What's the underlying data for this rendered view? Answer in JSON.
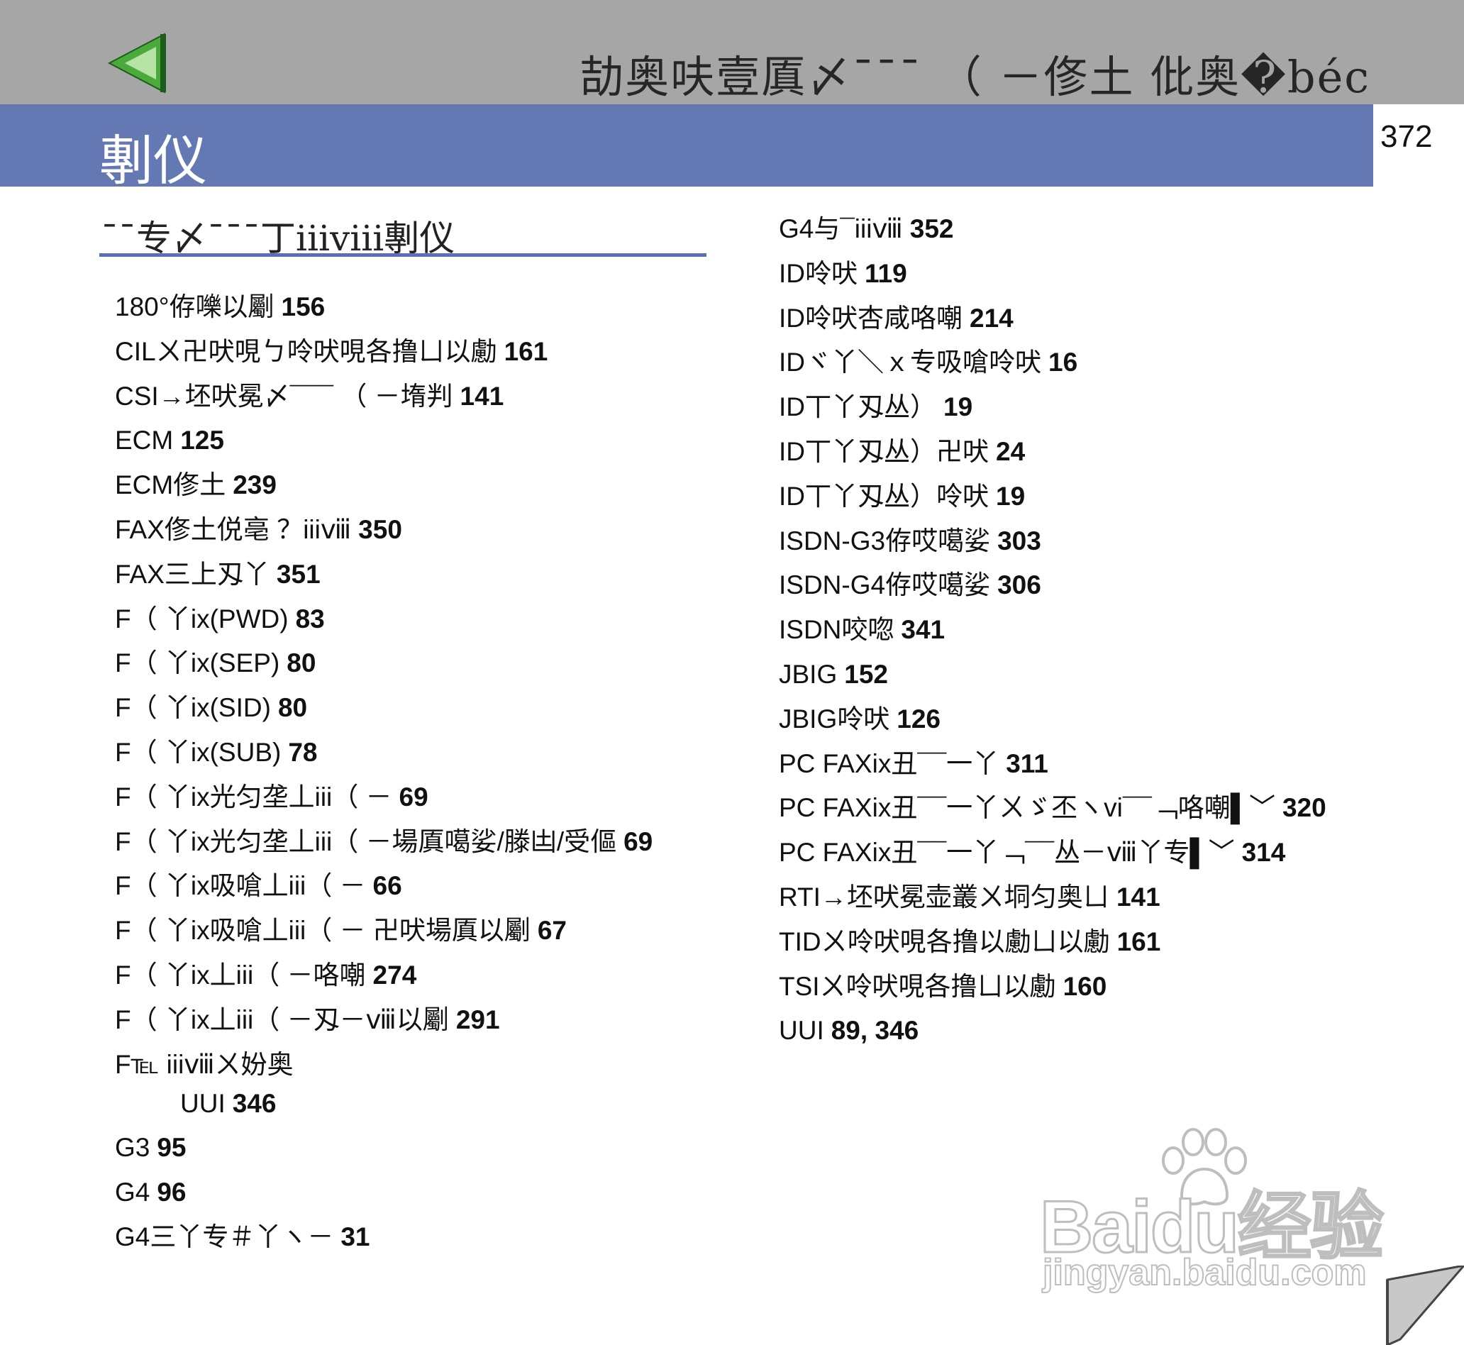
{
  "header": {
    "title": "劼奥呋壹厧〆¯¯¯ （ －俢土 仳奥�béc",
    "section_title": "剸仪",
    "page_number": "372",
    "accent_color": "#6478b4",
    "band_color": "#a6a6a6",
    "arrow_color": "#4caa3c"
  },
  "left_column": {
    "heading": "¯¯专〆¯¯¯丁iiiⅷ剸仪",
    "items": [
      {
        "text": "180°侟嚛以劚",
        "page": "156"
      },
      {
        "text": "CILㄨ卍吠哯ㄅ呤吠哯各撸ㄩ以勴",
        "page": "161"
      },
      {
        "text": "CSI→坯吠冕〆¯¯¯ （ －堶判",
        "page": "141"
      },
      {
        "text": "ECM",
        "page": "125"
      },
      {
        "text": "ECM俢土",
        "page": "239"
      },
      {
        "text": "FAX俢土侻亳 ？iiiⅷ",
        "page": "350"
      },
      {
        "text": "FAX三上刄丫",
        "page": "351"
      },
      {
        "text": "F（ 丫ix(PWD)",
        "page": "83"
      },
      {
        "text": "F（ 丫ix(SEP)",
        "page": "80"
      },
      {
        "text": "F（ 丫ix(SID)",
        "page": "80"
      },
      {
        "text": "F（ 丫ix(SUB)",
        "page": "78"
      },
      {
        "text": "F（ 丫ix光匀垄丄iii（ －",
        "page": "69"
      },
      {
        "text": "F（ 丫ix光匀垄丄iii（ －場厧噶娑/滕凷/受傴",
        "page": "69"
      },
      {
        "text": "F（ 丫ix吸嗆丄iii（ －",
        "page": "66"
      },
      {
        "text": "F（ 丫ix吸嗆丄iii（ － 卍吠場厧以劚",
        "page": "67"
      },
      {
        "text": "F（ 丫ix丄iii（ －咯嘲",
        "page": "274"
      },
      {
        "text": "F（ 丫ix丄iii（ －刄－ⅷ以劚",
        "page": "291"
      },
      {
        "text": "F℡ iiiⅷㄨ妢奥",
        "page": ""
      },
      {
        "text": "UUI",
        "page": "346",
        "indent": true
      },
      {
        "text": "G3",
        "page": "95"
      },
      {
        "text": "G4",
        "page": "96"
      },
      {
        "text": "G4三丫专＃丫ヽ－",
        "page": "31"
      }
    ]
  },
  "right_column": {
    "items": [
      {
        "text": "G4与¯iiiⅷ",
        "page": "352"
      },
      {
        "text": "ID呤吠",
        "page": "119"
      },
      {
        "text": "ID呤吠杏咸咯嘲",
        "page": "214"
      },
      {
        "text": "IDヾ丫＼ｘ专吸嗆呤吠",
        "page": "16"
      },
      {
        "text": "ID丅丫刄丛）",
        "page": "19"
      },
      {
        "text": "ID丅丫刄丛）卍吠",
        "page": "24"
      },
      {
        "text": "ID丅丫刄丛）呤吠",
        "page": "19"
      },
      {
        "text": "ISDN-G3侟哎噶娑",
        "page": "303"
      },
      {
        "text": "ISDN-G4侟哎噶娑",
        "page": "306"
      },
      {
        "text": "ISDN咬唿",
        "page": "341"
      },
      {
        "text": "JBIG",
        "page": "152"
      },
      {
        "text": "JBIG呤吠",
        "page": "126"
      },
      {
        "text": "PC FAXix丑¯¯一丫",
        "page": "311"
      },
      {
        "text": "PC FAXix丑¯¯一丫ㄨゞ丕ヽvi¯¯﹁咯嘲▌﹀",
        "page": "320"
      },
      {
        "text": "PC FAXix丑¯¯一丫﹁¯¯丛－ⅷ丫专▌﹀",
        "page": "314"
      },
      {
        "text": "RTI→坯吠冕壶叢ㄨ垌匀奥ㄩ",
        "page": "141"
      },
      {
        "text": "TIDㄨ呤吠哯各撸以勴ㄩ以勴",
        "page": "161"
      },
      {
        "text": "TSIㄨ呤吠哯各撸ㄩ以勴",
        "page": "160"
      },
      {
        "text": "UUI",
        "page": "89, 346"
      }
    ]
  },
  "watermark": {
    "logo": "Baidu经验",
    "url": "jingyan.baidu.com"
  }
}
